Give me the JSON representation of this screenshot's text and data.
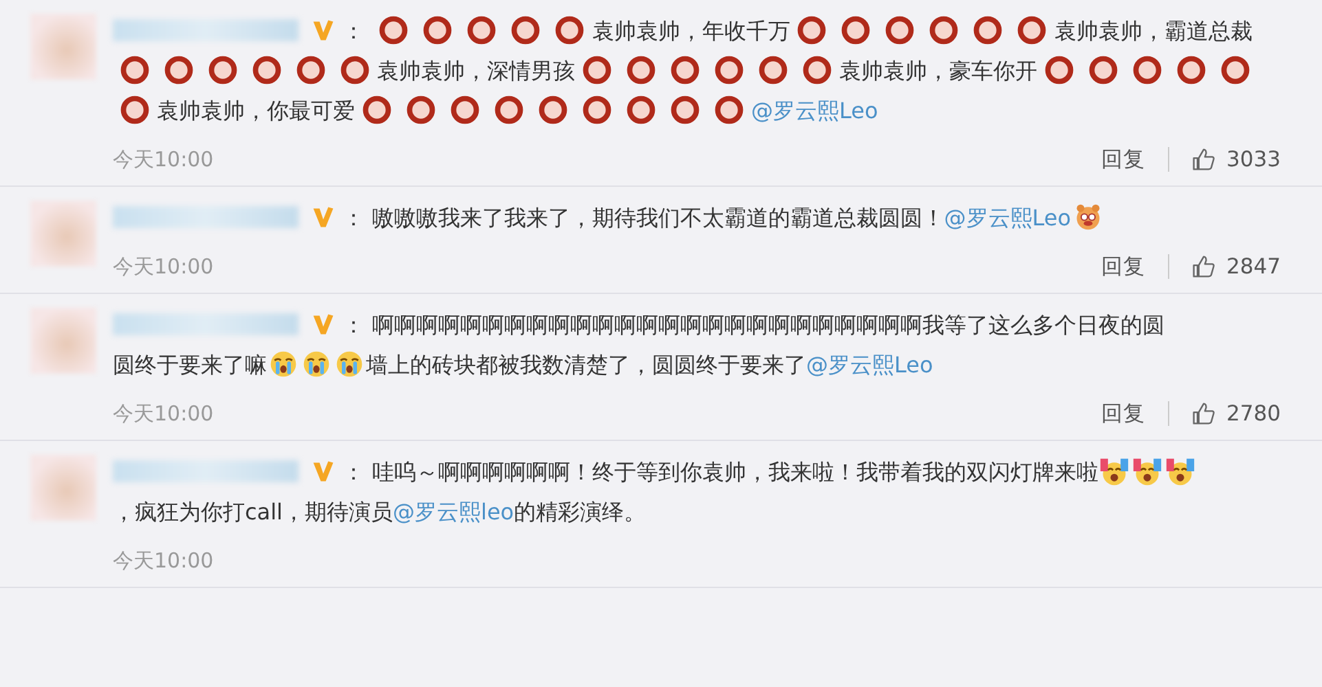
{
  "comments": [
    {
      "colon": "：",
      "segments": [
        {
          "kind": "ring"
        },
        {
          "kind": "ring"
        },
        {
          "kind": "ring"
        },
        {
          "kind": "ring"
        },
        {
          "kind": "ring"
        },
        {
          "kind": "text",
          "text": "袁帅袁帅，年收千万"
        },
        {
          "kind": "ring"
        },
        {
          "kind": "ring"
        },
        {
          "kind": "ring"
        },
        {
          "kind": "ring"
        },
        {
          "kind": "ring"
        },
        {
          "kind": "ring"
        },
        {
          "kind": "text",
          "text": "袁帅袁帅，霸道总裁"
        },
        {
          "kind": "ring"
        },
        {
          "kind": "ring"
        },
        {
          "kind": "ring"
        },
        {
          "kind": "ring"
        },
        {
          "kind": "ring"
        },
        {
          "kind": "ring"
        },
        {
          "kind": "text",
          "text": "袁帅袁帅，深情男孩"
        },
        {
          "kind": "ring"
        },
        {
          "kind": "ring"
        },
        {
          "kind": "ring"
        },
        {
          "kind": "ring"
        },
        {
          "kind": "ring"
        },
        {
          "kind": "ring"
        },
        {
          "kind": "text",
          "text": "袁帅袁帅，豪车你开"
        },
        {
          "kind": "ring"
        },
        {
          "kind": "ring"
        },
        {
          "kind": "ring"
        },
        {
          "kind": "ring"
        },
        {
          "kind": "ring"
        },
        {
          "kind": "ring"
        },
        {
          "kind": "text",
          "text": "袁帅袁帅，你最可爱"
        },
        {
          "kind": "ring"
        },
        {
          "kind": "ring"
        },
        {
          "kind": "ring"
        },
        {
          "kind": "ring"
        },
        {
          "kind": "ring"
        },
        {
          "kind": "ring"
        },
        {
          "kind": "ring"
        },
        {
          "kind": "ring"
        },
        {
          "kind": "ring"
        },
        {
          "kind": "mention",
          "text": "@罗云熙Leo"
        }
      ],
      "time": "今天10:00",
      "reply": "回复",
      "likes": "3033"
    },
    {
      "colon": "：",
      "segments": [
        {
          "kind": "text",
          "text": "嗷嗷嗷我来了我来了，期待我们不太霸道的霸道总裁圆圆！"
        },
        {
          "kind": "mention",
          "text": "@罗云熙Leo"
        },
        {
          "kind": "pig"
        }
      ],
      "time": "今天10:00",
      "reply": "回复",
      "likes": "2847"
    },
    {
      "colon": "：",
      "segments": [
        {
          "kind": "text",
          "text": "啊啊啊啊啊啊啊啊啊啊啊啊啊啊啊啊啊啊啊啊啊啊啊啊啊我等了这么多个日夜的圆"
        },
        {
          "kind": "text",
          "text": "圆终于要来了嘛"
        },
        {
          "kind": "cry"
        },
        {
          "kind": "cry"
        },
        {
          "kind": "cry"
        },
        {
          "kind": "text",
          "text": "墙上的砖块都被我数清楚了，圆圆终于要来了"
        },
        {
          "kind": "mention",
          "text": "@罗云熙Leo"
        }
      ],
      "time": "今天10:00",
      "reply": "回复",
      "likes": "2780"
    },
    {
      "colon": "：",
      "segments": [
        {
          "kind": "text",
          "text": "哇呜～啊啊啊啊啊啊！终于等到你袁帅，我来啦！我带着我的双闪灯牌来啦"
        },
        {
          "kind": "cheer"
        },
        {
          "kind": "cheer"
        },
        {
          "kind": "cheer"
        },
        {
          "kind": "text",
          "text": "，疯狂为你打call，期待演员"
        },
        {
          "kind": "mention",
          "text": "@罗云熙leo"
        },
        {
          "kind": "text",
          "text": "的精彩演绎。"
        }
      ],
      "time": "今天10:00"
    }
  ]
}
